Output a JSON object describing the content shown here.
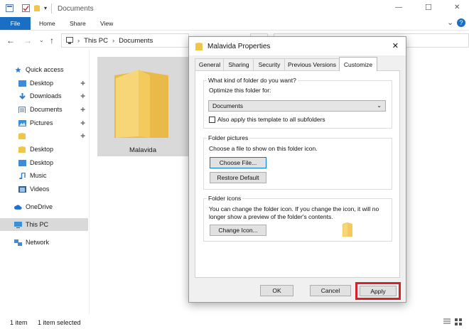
{
  "window": {
    "title": "Documents",
    "minimize": "—",
    "maximize": "☐",
    "close": "✕"
  },
  "ribbon": {
    "tabs": [
      "File",
      "Home",
      "Share",
      "View"
    ],
    "expand": "⌄",
    "help": "?"
  },
  "address": {
    "path": [
      "This PC",
      "Documents"
    ],
    "back": "←",
    "forward": "→",
    "up": "↑"
  },
  "nav": {
    "items": [
      {
        "label": "Quick access",
        "icon": "star-icon",
        "color": "#2b7cd3"
      },
      {
        "label": "Desktop",
        "icon": "desktop-icon",
        "color": "#3b8ed8",
        "pinned": true
      },
      {
        "label": "Downloads",
        "icon": "download-icon",
        "color": "#2b7cd3",
        "pinned": true
      },
      {
        "label": "Documents",
        "icon": "documents-icon",
        "color": "#6b7d95",
        "pinned": true
      },
      {
        "label": "Pictures",
        "icon": "pictures-icon",
        "color": "#3b8ed8",
        "pinned": true
      },
      {
        "label": "",
        "icon": "folder-icon",
        "color": "#f0c64a",
        "pinned": true
      },
      {
        "label": "Desktop",
        "icon": "folder-icon",
        "color": "#f0c64a"
      },
      {
        "label": "Desktop",
        "icon": "desktop-icon",
        "color": "#3b8ed8"
      },
      {
        "label": "Music",
        "icon": "music-icon",
        "color": "#2b7cd3"
      },
      {
        "label": "Videos",
        "icon": "videos-icon",
        "color": "#3b5f8a"
      },
      {
        "label": "OneDrive",
        "icon": "cloud-icon",
        "color": "#1e6fd9"
      },
      {
        "label": "This PC",
        "icon": "pc-icon",
        "color": "#3b8ed8",
        "selected": true
      },
      {
        "label": "Network",
        "icon": "network-icon",
        "color": "#3b8ed8"
      }
    ]
  },
  "content": {
    "folder_name": "Malavida"
  },
  "status": {
    "count": "1 item",
    "selected": "1 item selected"
  },
  "dialog": {
    "title": "Malavida Properties",
    "close": "✕",
    "tabs": [
      "General",
      "Sharing",
      "Security",
      "Previous Versions",
      "Customize"
    ],
    "active_tab": "Customize",
    "kind_group": "What kind of folder do you want?",
    "optimize_label": "Optimize this folder for:",
    "optimize_value": "Documents",
    "apply_subfolders": "Also apply this template to all subfolders",
    "pictures_group": "Folder pictures",
    "pictures_desc": "Choose a file to show on this folder icon.",
    "choose_file": "Choose File...",
    "restore_default": "Restore Default",
    "icons_group": "Folder icons",
    "icons_desc_1": "You can change the folder icon. If you change the icon, it will no",
    "icons_desc_2": "longer show a preview of the folder's contents.",
    "change_icon": "Change Icon...",
    "ok": "OK",
    "cancel": "Cancel",
    "apply": "Apply",
    "highlight_color": "#d2232a",
    "accent_color": "#0078d7"
  }
}
